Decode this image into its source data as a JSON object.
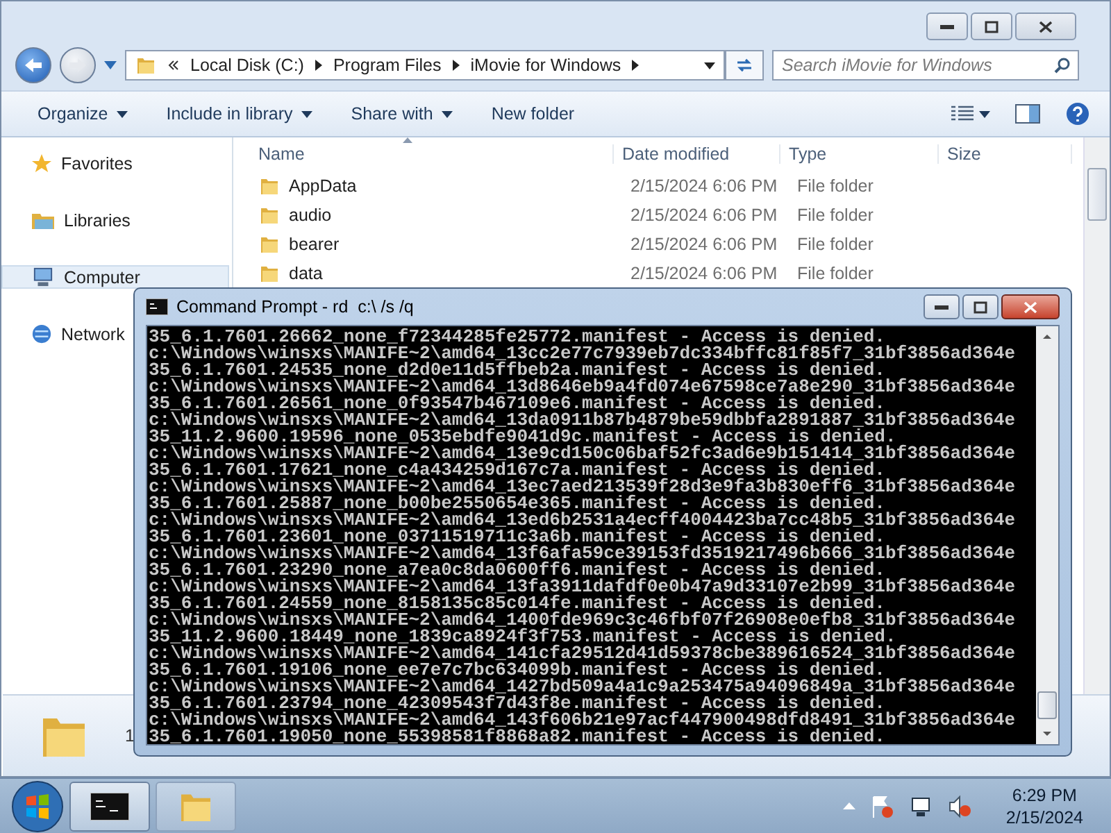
{
  "explorer": {
    "breadcrumb": [
      "Local Disk (C:)",
      "Program Files",
      "iMovie for Windows"
    ],
    "search": {
      "placeholder": "Search iMovie for Windows"
    },
    "toolbar": [
      {
        "label": "Organize",
        "dropdown": true
      },
      {
        "label": "Include in library",
        "dropdown": true
      },
      {
        "label": "Share with",
        "dropdown": true
      },
      {
        "label": "New folder",
        "dropdown": false
      }
    ],
    "nav": [
      {
        "label": "Favorites",
        "kind": "star",
        "selected": false
      },
      {
        "label": "Libraries",
        "kind": "library",
        "selected": false
      },
      {
        "label": "Computer",
        "kind": "computer",
        "selected": true
      },
      {
        "label": "Network",
        "kind": "network",
        "selected": false
      }
    ],
    "columns": [
      "Name",
      "Date modified",
      "Type",
      "Size"
    ],
    "rows": [
      {
        "name": "AppData",
        "date": "2/15/2024 6:06 PM",
        "type": "File folder"
      },
      {
        "name": "audio",
        "date": "2/15/2024 6:06 PM",
        "type": "File folder"
      },
      {
        "name": "bearer",
        "date": "2/15/2024 6:06 PM",
        "type": "File folder"
      },
      {
        "name": "data",
        "date": "2/15/2024 6:06 PM",
        "type": "File folder"
      }
    ],
    "details": "1"
  },
  "cmd": {
    "title": "Command Prompt - rd  c:\\ /s /q",
    "lines": [
      "35_6.1.7601.26662_none_f72344285fe25772.manifest - Access is denied.",
      "c:\\Windows\\winsxs\\MANIFE~2\\amd64_13cc2e77c7939eb7dc334bffc81f85f7_31bf3856ad364e",
      "35_6.1.7601.24535_none_d2d0e11d5ffbeb2a.manifest - Access is denied.",
      "c:\\Windows\\winsxs\\MANIFE~2\\amd64_13d8646eb9a4fd074e67598ce7a8e290_31bf3856ad364e",
      "35_6.1.7601.26561_none_0f93547b467109e6.manifest - Access is denied.",
      "c:\\Windows\\winsxs\\MANIFE~2\\amd64_13da0911b87b4879be59dbbfa2891887_31bf3856ad364e",
      "35_11.2.9600.19596_none_0535ebdfe9041d9c.manifest - Access is denied.",
      "c:\\Windows\\winsxs\\MANIFE~2\\amd64_13e9cd150c06baf52fc3ad6e9b151414_31bf3856ad364e",
      "35_6.1.7601.17621_none_c4a434259d167c7a.manifest - Access is denied.",
      "c:\\Windows\\winsxs\\MANIFE~2\\amd64_13ec7aed213539f28d3e9fa3b830eff6_31bf3856ad364e",
      "35_6.1.7601.25887_none_b00be2550654e365.manifest - Access is denied.",
      "c:\\Windows\\winsxs\\MANIFE~2\\amd64_13ed6b2531a4ecff4004423ba7cc48b5_31bf3856ad364e",
      "35_6.1.7601.23601_none_03711519711c3a6b.manifest - Access is denied.",
      "c:\\Windows\\winsxs\\MANIFE~2\\amd64_13f6afa59ce39153fd3519217496b666_31bf3856ad364e",
      "35_6.1.7601.23290_none_a7ea0c8da0600ff6.manifest - Access is denied.",
      "c:\\Windows\\winsxs\\MANIFE~2\\amd64_13fa3911dafdf0e0b47a9d33107e2b99_31bf3856ad364e",
      "35_6.1.7601.24559_none_8158135c85c014fe.manifest - Access is denied.",
      "c:\\Windows\\winsxs\\MANIFE~2\\amd64_1400fde969c3c46fbf07f26908e0efb8_31bf3856ad364e",
      "35_11.2.9600.18449_none_1839ca8924f3f753.manifest - Access is denied.",
      "c:\\Windows\\winsxs\\MANIFE~2\\amd64_141cfa29512d41d59378cbe389616524_31bf3856ad364e",
      "35_6.1.7601.19106_none_ee7e7c7bc634099b.manifest - Access is denied.",
      "c:\\Windows\\winsxs\\MANIFE~2\\amd64_1427bd509a4a1c9a253475a94096849a_31bf3856ad364e",
      "35_6.1.7601.23794_none_42309543f7d43f8e.manifest - Access is denied.",
      "c:\\Windows\\winsxs\\MANIFE~2\\amd64_143f606b21e97acf447900498dfd8491_31bf3856ad364e",
      "35_6.1.7601.19050_none_55398581f8868a82.manifest - Access is denied."
    ]
  },
  "taskbar": {
    "apps": [
      {
        "kind": "console",
        "selected": true
      },
      {
        "kind": "folder",
        "selected": false
      }
    ],
    "time": "6:29 PM",
    "date": "2/15/2024"
  }
}
